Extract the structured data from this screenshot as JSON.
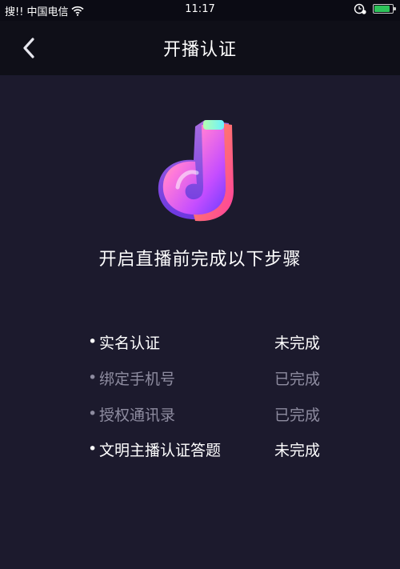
{
  "status_bar": {
    "carrier_prefix": "搜!!",
    "carrier": "中国电信",
    "time": "11:17",
    "battery_percent": 85
  },
  "nav": {
    "title": "开播认证",
    "back_icon": "chevron-left-icon"
  },
  "logo": {
    "icon": "music-note-app-logo"
  },
  "headline": "开启直播前完成以下步骤",
  "steps": [
    {
      "bullet": "•",
      "name": "实名认证",
      "status": "未完成",
      "done": false
    },
    {
      "bullet": "•",
      "name": "绑定手机号",
      "status": "已完成",
      "done": true
    },
    {
      "bullet": "•",
      "name": "授权通讯录",
      "status": "已完成",
      "done": true
    },
    {
      "bullet": "•",
      "name": "文明主播认证答题",
      "status": "未完成",
      "done": false
    }
  ],
  "colors": {
    "background": "#1c1a2d",
    "nav_background": "#0f0f18",
    "done_text": "#8e8ca0",
    "todo_text": "#ffffff"
  }
}
